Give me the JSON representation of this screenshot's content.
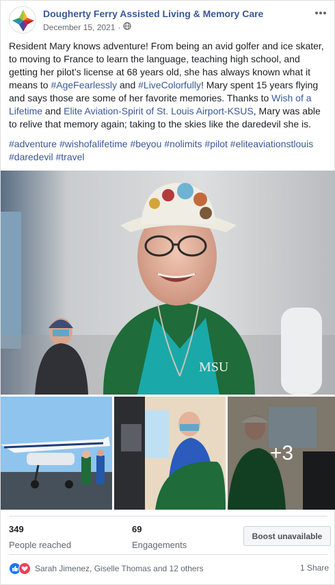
{
  "post": {
    "page_name": "Dougherty Ferry Assisted Living & Memory Care",
    "date": "December 15, 2021",
    "separator": "·",
    "privacy_icon": "globe-icon",
    "more_icon": "more-dots-icon"
  },
  "caption": {
    "t1": "Resident Mary knows adventure! From being an avid golfer and ice skater, to moving to France to learn the language, teaching high school, and getting her pilot’s license at 68 years old, she has always known what it means to ",
    "tag1": "#AgeFearlessly",
    "t2": " and ",
    "tag2": "#LiveColorfully",
    "t3": "! Mary spent 15 years flying and says those are some of her favorite memories. Thanks to ",
    "link1": "Wish of a Lifetime",
    "t4": " and ",
    "link2": "Elite Aviation-Spirit of St. Louis Airport-KSUS",
    "t5": ", Mary was able to relive that memory again; taking to the skies like the daredevil she is."
  },
  "hashtags": [
    "#adventure",
    "#wishofalifetime",
    "#beyou",
    "#nolimits",
    "#pilot",
    "#eliteaviationstlouis",
    "#daredevil",
    "#travel"
  ],
  "photos": {
    "more_count": "+3",
    "main_jacket_text": "MSU"
  },
  "stats": {
    "reached_value": "349",
    "reached_label": "People reached",
    "engagements_value": "69",
    "engagements_label": "Engagements",
    "boost_label": "Boost unavailable"
  },
  "reactions": {
    "icons": [
      "like-icon",
      "love-icon"
    ],
    "names": "Sarah Jimenez, Giselle Thomas and 12 others",
    "shares": "1 Share"
  },
  "colors": {
    "link": "#385898",
    "like": "#1877f2",
    "love": "#f33e58",
    "jacket_green": "#1f6b3a"
  }
}
